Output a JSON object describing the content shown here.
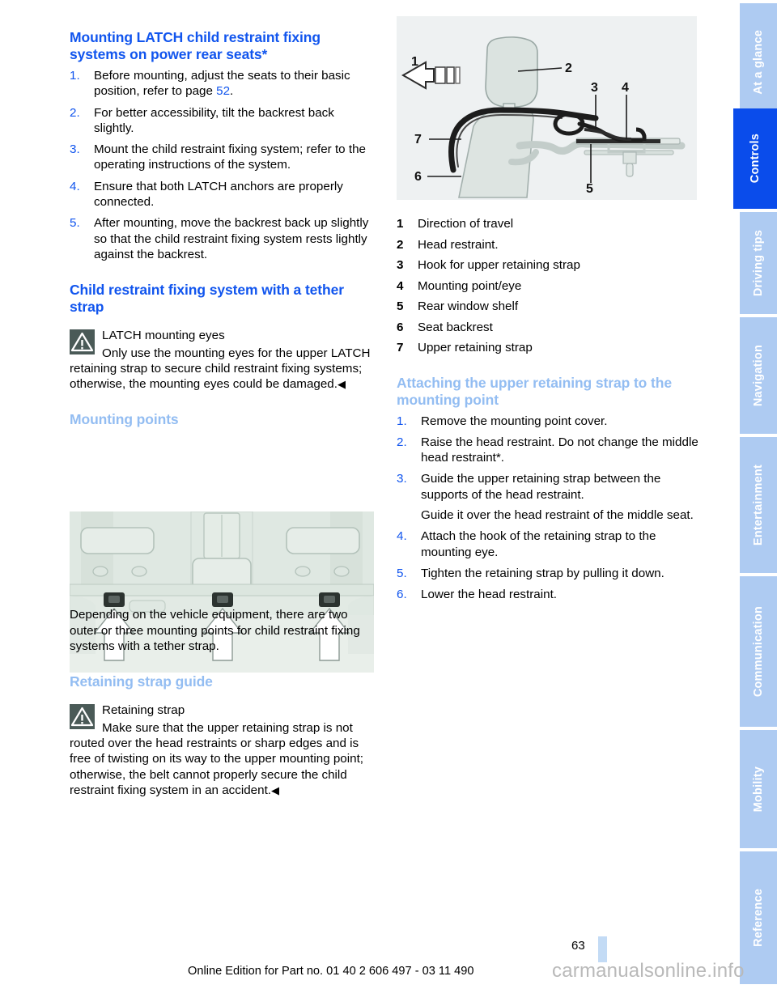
{
  "page": {
    "number": "63",
    "footer_line": "Online Edition for Part no. 01 40 2 606 497 - 03 11 490",
    "watermark": "carmanualsonline.info"
  },
  "colors": {
    "heading_strong": "#1155ee",
    "heading_light": "#93bdf2",
    "tab_inactive": "#aecbf2",
    "tab_active": "#0a4ceb",
    "warning_box": "#4a5a57",
    "figure_bg": "#eef1f2"
  },
  "left_column": {
    "heading_1": "Mounting LATCH child restraint fixing systems on power rear seats*",
    "steps_1": [
      {
        "num": "1.",
        "text": "Before mounting, adjust the seats to their basic position, refer to page 52."
      },
      {
        "num": "2.",
        "text": "For better accessibility, tilt the backrest back slightly."
      },
      {
        "num": "3.",
        "text": "Mount the child restraint fixing system; refer to the operating instructions of the system."
      },
      {
        "num": "4.",
        "text": "Ensure that both LATCH anchors are properly connected."
      },
      {
        "num": "5.",
        "text": "After mounting, move the backrest back up slightly so that the child restraint fixing system rests lightly against the backrest."
      }
    ],
    "step_1_page_ref": "52",
    "heading_2": "Child restraint fixing system with a tether strap",
    "note_1": {
      "icon": "warning-triangle-icon",
      "title": "LATCH mounting eyes",
      "body": "Only use the mounting eyes for the upper LATCH retaining strap to secure child restraint fixing systems; otherwise, the mounting eyes could be damaged.",
      "endmark": "◀"
    },
    "heading_3": "Mounting points",
    "figure_2_caption": "Depending on the vehicle equipment, there are two outer or three mounting points for child restraint fixing systems with a tether strap.",
    "heading_4": "Retaining strap guide",
    "note_2": {
      "icon": "warning-triangle-icon",
      "title": "Retaining strap",
      "body": "Make sure that the upper retaining strap is not routed over the head restraints or sharp edges and is free of twisting on its way to the upper mounting point; otherwise, the belt cannot properly secure the child restraint fixing system in an accident.",
      "endmark": "◀"
    }
  },
  "right_column": {
    "figure_1_labels": [
      "1",
      "2",
      "3",
      "4",
      "5",
      "6",
      "7"
    ],
    "legend": [
      {
        "num": "1",
        "text": "Direction of travel"
      },
      {
        "num": "2",
        "text": "Head restraint."
      },
      {
        "num": "3",
        "text": "Hook for upper retaining strap"
      },
      {
        "num": "4",
        "text": "Mounting point/eye"
      },
      {
        "num": "5",
        "text": "Rear window shelf"
      },
      {
        "num": "6",
        "text": "Seat backrest"
      },
      {
        "num": "7",
        "text": "Upper retaining strap"
      }
    ],
    "heading_1": "Attaching the upper retaining strap to the mounting point",
    "steps": [
      {
        "num": "1.",
        "text": "Remove the mounting point cover."
      },
      {
        "num": "2.",
        "text": "Raise the head restraint. Do not change the middle head restraint*."
      },
      {
        "num": "3.",
        "text": "Guide the upper retaining strap between the supports of the head restraint.",
        "sub": "Guide it over the head restraint of the middle seat."
      },
      {
        "num": "4.",
        "text": "Attach the hook of the retaining strap to the mounting eye."
      },
      {
        "num": "5.",
        "text": "Tighten the retaining strap by pulling it down."
      },
      {
        "num": "6.",
        "text": "Lower the head restraint."
      }
    ]
  },
  "sidebar": {
    "tabs": [
      {
        "label": "At a glance",
        "active": false
      },
      {
        "label": "Controls",
        "active": true
      },
      {
        "label": "Driving tips",
        "active": false
      },
      {
        "label": "Navigation",
        "active": false
      },
      {
        "label": "Entertainment",
        "active": false
      },
      {
        "label": "Communication",
        "active": false
      },
      {
        "label": "Mobility",
        "active": false
      },
      {
        "label": "Reference",
        "active": false
      }
    ]
  }
}
